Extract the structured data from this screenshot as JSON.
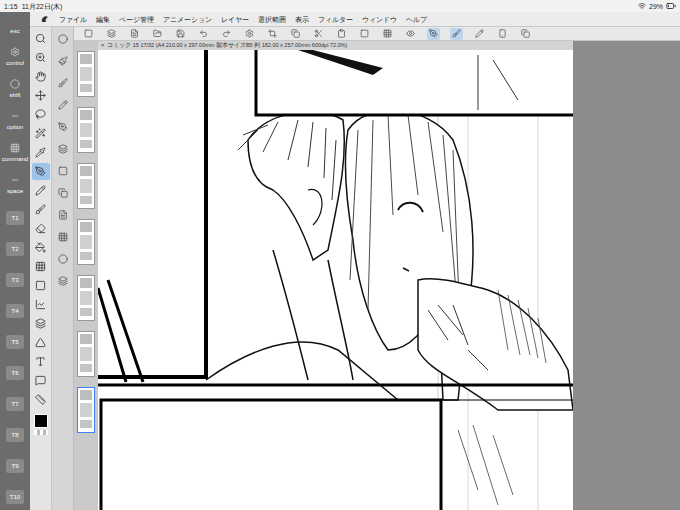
{
  "status_bar": {
    "time": "1:15",
    "date": "11月22日(木)",
    "battery": "29%"
  },
  "menu": [
    "ファイル",
    "編集",
    "ページ管理",
    "アニメーション",
    "レイヤー",
    "選択範囲",
    "表示",
    "フィルター",
    "ウィンドウ",
    "ヘルプ"
  ],
  "keys": [
    {
      "label": "esc"
    },
    {
      "label": "control"
    },
    {
      "label": "shift"
    },
    {
      "label": "option"
    },
    {
      "label": "command"
    },
    {
      "label": "space"
    },
    {
      "label": "T1"
    },
    {
      "label": "T2"
    },
    {
      "label": "T3"
    },
    {
      "label": "T4"
    },
    {
      "label": "T5"
    },
    {
      "label": "T6"
    },
    {
      "label": "T7"
    },
    {
      "label": "T8"
    },
    {
      "label": "T9"
    },
    {
      "label": "T10"
    }
  ],
  "tools": [
    {
      "selected": false
    },
    {
      "selected": false
    },
    {
      "selected": false
    },
    {
      "selected": false
    },
    {
      "selected": false
    },
    {
      "selected": false
    },
    {
      "selected": false
    },
    {
      "selected": true
    },
    {
      "selected": false
    },
    {
      "selected": false
    },
    {
      "selected": false
    },
    {
      "selected": false
    },
    {
      "selected": false
    },
    {
      "selected": false
    },
    {
      "selected": false
    },
    {
      "selected": false
    },
    {
      "selected": false
    },
    {
      "selected": false
    },
    {
      "selected": false
    },
    {
      "selected": false
    }
  ],
  "command_bar": [
    {
      "selected": false
    },
    {
      "selected": false
    },
    {
      "selected": false
    },
    {
      "selected": false
    },
    {
      "selected": false
    },
    {
      "selected": false
    },
    {
      "selected": false
    },
    {
      "selected": false
    },
    {
      "selected": false
    },
    {
      "selected": false
    },
    {
      "selected": false
    },
    {
      "selected": false
    },
    {
      "selected": false
    },
    {
      "selected": false
    },
    {
      "selected": false
    },
    {
      "selected": true
    },
    {
      "selected": true
    },
    {
      "selected": false
    },
    {
      "selected": false
    },
    {
      "selected": false
    }
  ],
  "pages": [
    {
      "selected": false
    },
    {
      "selected": false
    },
    {
      "selected": false
    },
    {
      "selected": false
    },
    {
      "selected": false
    },
    {
      "selected": false
    },
    {
      "selected": true
    }
  ],
  "canvas_tab": {
    "close": "×",
    "title": "コミック 15 17/32 (A4 210.00 x 297.00mm 製本サイズB5 判 182.00 x 257.00mm 600dpi 72.0%)"
  },
  "main_color": "#000000"
}
